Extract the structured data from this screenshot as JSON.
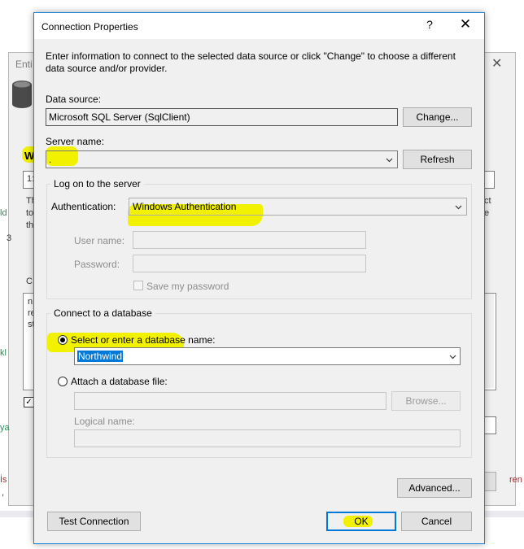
{
  "background": {
    "window_title": "Enti",
    "heading": "W",
    "field_text": "1:",
    "info_lines": [
      "Th",
      "to",
      "th"
    ],
    "right_lines": [
      "ct",
      "e"
    ],
    "code_lines": [
      {
        "text": "ld",
        "tone": "green"
      },
      {
        "text": "3",
        "tone": "plain"
      },
      {
        "text": "kl",
        "tone": "green"
      },
      {
        "text": "ya",
        "tone": "green"
      },
      {
        "text": "İs",
        "tone": "red"
      },
      {
        "text": ",",
        "tone": "plain"
      },
      {
        "text": "ren",
        "tone": "red"
      }
    ],
    "list_caption": "C",
    "list_lines": [
      "n",
      "re",
      "st"
    ]
  },
  "dialog": {
    "title": "Connection Properties",
    "help_label": "?",
    "close_label": "✕",
    "intro_text": "Enter information to connect to the selected data source or click \"Change\" to choose a different data source and/or provider.",
    "data_source": {
      "label": "Data source:",
      "value": "Microsoft SQL Server (SqlClient)",
      "change_label": "Change..."
    },
    "server": {
      "label": "Server name:",
      "value": ".",
      "refresh_label": "Refresh"
    },
    "logon": {
      "caption": "Log on to the server",
      "auth_label": "Authentication:",
      "auth_value": "Windows Authentication",
      "user_label": "User name:",
      "password_label": "Password:",
      "save_password_label": "Save my password"
    },
    "database": {
      "caption": "Connect to a database",
      "select_label": "Select or enter a database name:",
      "select_value": "Northwind",
      "attach_label": "Attach a database file:",
      "browse_label": "Browse...",
      "logical_label": "Logical name:"
    },
    "buttons": {
      "advanced": "Advanced...",
      "test": "Test Connection",
      "ok": "OK",
      "cancel": "Cancel"
    }
  }
}
